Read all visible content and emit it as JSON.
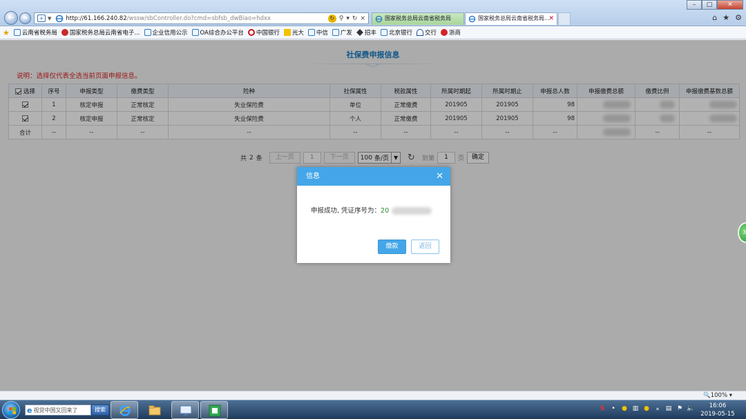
{
  "browser": {
    "url_host": "http://61.166.240.82",
    "url_path": "/wssw/sbController.do?cmd=sbfsb_dwBiao=hdxx",
    "tabs": [
      {
        "label": "国家税务总局云南省税务局"
      },
      {
        "label": "国家税务总局云南省税务局..."
      }
    ],
    "favorites": [
      {
        "label": "云南省税务局"
      },
      {
        "label": "国家税务总局云南省电子..."
      },
      {
        "label": "企业信用公示"
      },
      {
        "label": "OA综合办公平台"
      },
      {
        "label": "中国银行"
      },
      {
        "label": "光大"
      },
      {
        "label": "中信"
      },
      {
        "label": "广发"
      },
      {
        "label": "招丰"
      },
      {
        "label": "北京银行"
      },
      {
        "label": "交行"
      },
      {
        "label": "浙商"
      }
    ],
    "zoom": "100%"
  },
  "page": {
    "title": "社保费申报信息",
    "notice": "说明：选择仅代表全选当前页面申报信息。"
  },
  "table": {
    "headers": [
      "选择",
      "序号",
      "申报类型",
      "缴费类型",
      "险种",
      "社保属性",
      "税款属性",
      "所属时期起",
      "所属时期止",
      "申报总人数",
      "申报缴费总额",
      "缴费比例",
      "申报缴费基数总额"
    ],
    "rows": [
      {
        "seq": "1",
        "report_type": "核定申报",
        "pay_type": "正常核定",
        "insurance": "失业保险费",
        "attr": "单位",
        "tax_attr": "正常缴费",
        "from": "201905",
        "to": "201905",
        "count": "98"
      },
      {
        "seq": "2",
        "report_type": "核定申报",
        "pay_type": "正常核定",
        "insurance": "失业保险费",
        "attr": "个人",
        "tax_attr": "正常缴费",
        "from": "201905",
        "to": "201905",
        "count": "98"
      }
    ],
    "total_label": "合计",
    "dash": "--"
  },
  "pager": {
    "total_prefix": "共",
    "total_count": "2",
    "total_suffix": "条",
    "prev": "上一页",
    "page": "1",
    "next": "下一页",
    "per_page": "100",
    "per_page_unit": "条/页",
    "goto_label": "到第",
    "goto_page": "1",
    "page_unit": "页",
    "confirm": "确定"
  },
  "side_bubble": "30",
  "dialog": {
    "title": "信息",
    "message": "申报成功, 凭证序号为：",
    "serial_prefix": "20",
    "pay_label": "缴款",
    "back_label": "返回"
  },
  "taskbar": {
    "search_text": "视觉中国又回来了",
    "search_button": "搜索",
    "time": "16:06",
    "date": "2019-05-15"
  },
  "colors": {
    "accent": "#44a6e8",
    "title_blue": "#1e7fc5",
    "notice_red": "#d22222"
  }
}
